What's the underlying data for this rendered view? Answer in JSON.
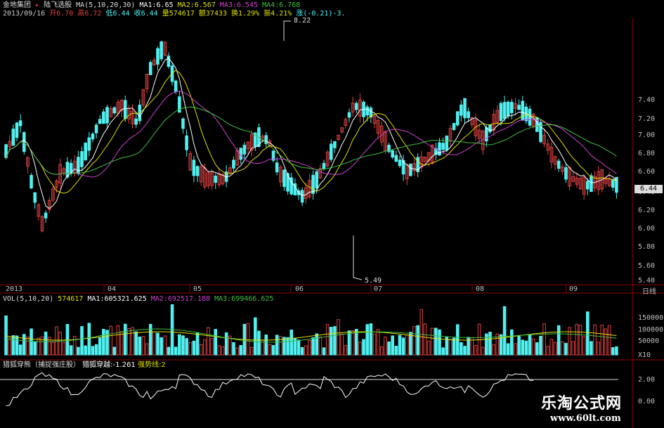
{
  "header": {
    "stock_name": "金地集团",
    "flag": "陆飞选股",
    "ma_label": "MA(5,10,20,30)",
    "ma1": "MA1:6.65",
    "ma2": "MA2:6.567",
    "ma3": "MA3:6.545",
    "ma4": "MA4:6.768",
    "line2_date": "2013/09/16",
    "open": "开6.70",
    "high": "高6.72",
    "low": "低6.44",
    "close": "收6.44",
    "volume": "量574617",
    "amount": "额37433",
    "turnover": "换1.29%",
    "amplitude": "振4.21%",
    "change": "涨(-0.21)-3."
  },
  "price_axis": {
    "labels": [
      "7.40",
      "7.20",
      "7.00",
      "6.80",
      "6.60",
      "6.40",
      "6.20",
      "6.00",
      "5.80",
      "5.60",
      "5.40"
    ],
    "current_tag": "6.44",
    "high_annotation": "8.22",
    "low_annotation": "5.49"
  },
  "time_axis": {
    "labels": [
      "2013",
      "04",
      "05",
      "06",
      "07",
      "08",
      "09"
    ],
    "period": "日线"
  },
  "volume_panel": {
    "header_label": "VOL(5,10,20)",
    "value": "574617",
    "ma1": "MA1:605321.625",
    "ma2": "MA2:692517.188",
    "ma3": "MA3:699466.625",
    "axis_labels": [
      "150000",
      "100000",
      "50000"
    ],
    "unit": "X10"
  },
  "indicator_panel": {
    "name": "猎狐穿熊（捕捉强庄股）",
    "value_label": "猎狐穿越:-1.261",
    "strong_label": "强势线:2",
    "axis_labels": [
      "2.00",
      "0.00"
    ]
  },
  "watermark": {
    "title": "乐淘公式网",
    "url": "www.60lt.com"
  },
  "colors": {
    "up": "#e04040",
    "down": "#50f0f0",
    "ma1": "#ffffff",
    "ma2": "#e0e000",
    "ma3": "#d040d0",
    "ma4": "#40c040",
    "grid": "#8b0000"
  }
}
